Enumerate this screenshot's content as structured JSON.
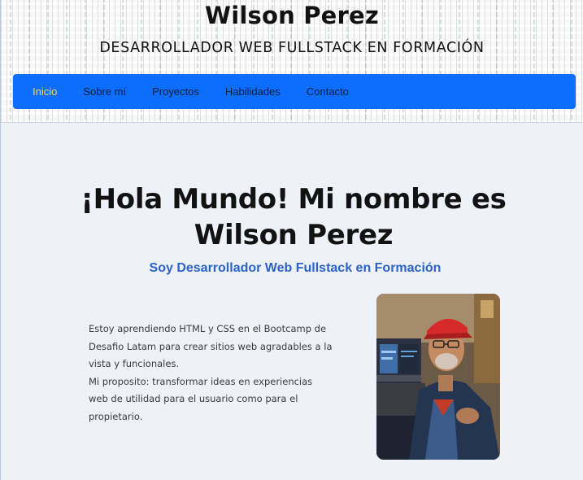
{
  "header": {
    "title": "Wilson Perez",
    "subtitle": "DESARROLLADOR WEB FULLSTACK EN FORMACIÓN"
  },
  "nav": {
    "items": [
      {
        "label": "Inicio",
        "active": true
      },
      {
        "label": "Sobre mí"
      },
      {
        "label": "Proyectos"
      },
      {
        "label": "Habilidades"
      },
      {
        "label": "Contacto"
      }
    ]
  },
  "hero": {
    "title_line1": "¡Hola Mundo! Mi nombre es",
    "title_line2": "Wilson Perez",
    "subtitle": "Soy Desarrollador Web Fullstack en Formación"
  },
  "about": {
    "paragraph1": "Estoy aprendiendo HTML y CSS en el Bootcamp de Desafio Latam para crear sitios web agradables a la vista y funcionales.",
    "paragraph2": "Mi proposito: transformar ideas en experiencias web de utilidad para el usuario como para el propietario."
  },
  "colors": {
    "navbar": "#0d6efd",
    "nav_active": "#ffd84a",
    "hero_subtitle": "#2b63c9",
    "background": "#eef2f8"
  }
}
